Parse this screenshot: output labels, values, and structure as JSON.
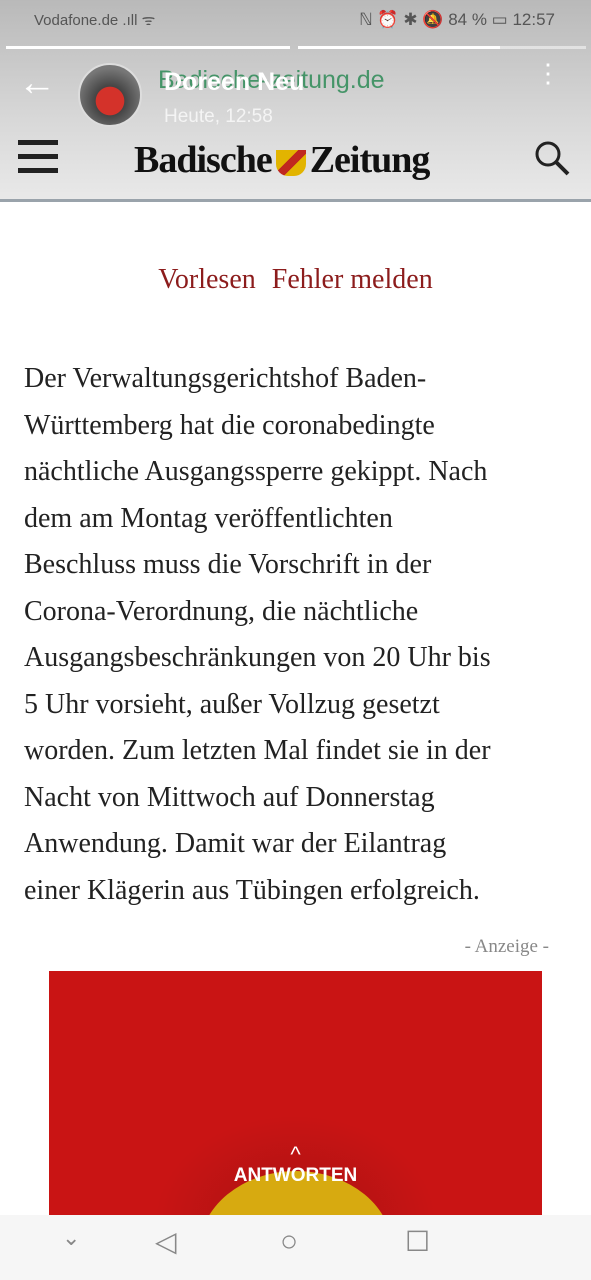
{
  "status_bar": {
    "carrier": "Vodafone.de",
    "icons_text": "ℕ ⏰ ✱ 🔕 84 % ▭ 12:57",
    "battery": "84 %",
    "clock": "12:57"
  },
  "story": {
    "progress": [
      1.0,
      0.7
    ],
    "name": "Doreen Neu",
    "time": "Heute, 12:58",
    "url": "Badische-zeitung.de"
  },
  "site": {
    "logo_left": "Badische",
    "logo_right": "Zeitung"
  },
  "tools": {
    "read_aloud": "Vorlesen",
    "report_error": "Fehler melden"
  },
  "article": {
    "lines": [
      "Der Verwaltungsgerichtshof Baden-",
      "Württemberg hat die coronabedingte",
      "nächtliche Ausgangssperre gekippt. Nach",
      "dem am Montag veröffentlichten",
      "Beschluss muss die Vorschrift in der",
      "Corona-Verordnung, die nächtliche",
      "Ausgangsbeschränkungen von 20 Uhr bis",
      "5 Uhr vorsieht, außer Vollzug gesetzt",
      "worden. Zum letzten Mal findet sie in der",
      "Nacht von Mittwoch auf Donnerstag",
      "Anwendung. Damit war der Eilantrag",
      "einer Klägerin aus Tübingen erfolgreich."
    ]
  },
  "ad": {
    "label": "- Anzeige -"
  },
  "reply": {
    "label": "ANTWORTEN"
  }
}
